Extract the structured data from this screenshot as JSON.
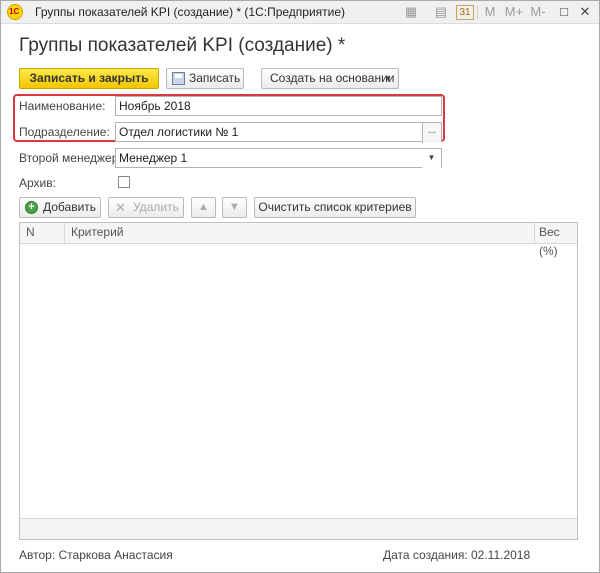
{
  "window": {
    "title": "Группы показателей KPI (создание) *  (1С:Предприятие)",
    "toolbar_icons": [
      {
        "name": "save-all-icon",
        "glyph": "▦"
      },
      {
        "name": "calendar-icon",
        "glyph": "31"
      },
      {
        "name": "memory-icon",
        "label": "M"
      },
      {
        "name": "memory-plus-icon",
        "label": "M+"
      },
      {
        "name": "memory-minus-icon",
        "label": "M-"
      },
      {
        "name": "maximize-icon",
        "glyph": "□"
      },
      {
        "name": "close-icon",
        "glyph": "✕"
      }
    ]
  },
  "page": {
    "title": "Группы показателей KPI (создание) *"
  },
  "toolbar": {
    "save_close": "Записать и закрыть",
    "save": "Записать",
    "create_based_on": "Создать на основании"
  },
  "form": {
    "name_label": "Наименование:",
    "name_value": "Ноябрь 2018",
    "division_label": "Подразделение:",
    "division_value": "Отдел логистики № 1",
    "division_btn": "...",
    "manager_label": "Второй менеджер:",
    "manager_value": "Менеджер 1",
    "archive_label": "Архив:",
    "archive_checked": false
  },
  "table_toolbar": {
    "add": "Добавить",
    "delete": "Удалить",
    "clear": "Очистить список критериев"
  },
  "table": {
    "columns": [
      "N",
      "Критерий",
      "Вес (%)"
    ],
    "rows": []
  },
  "footer": {
    "author": "Автор: Старкова Анастасия",
    "created": "Дата создания: 02.11.2018"
  },
  "colors": {
    "primary_button": "#f2c600",
    "highlight": "#d9383f"
  }
}
